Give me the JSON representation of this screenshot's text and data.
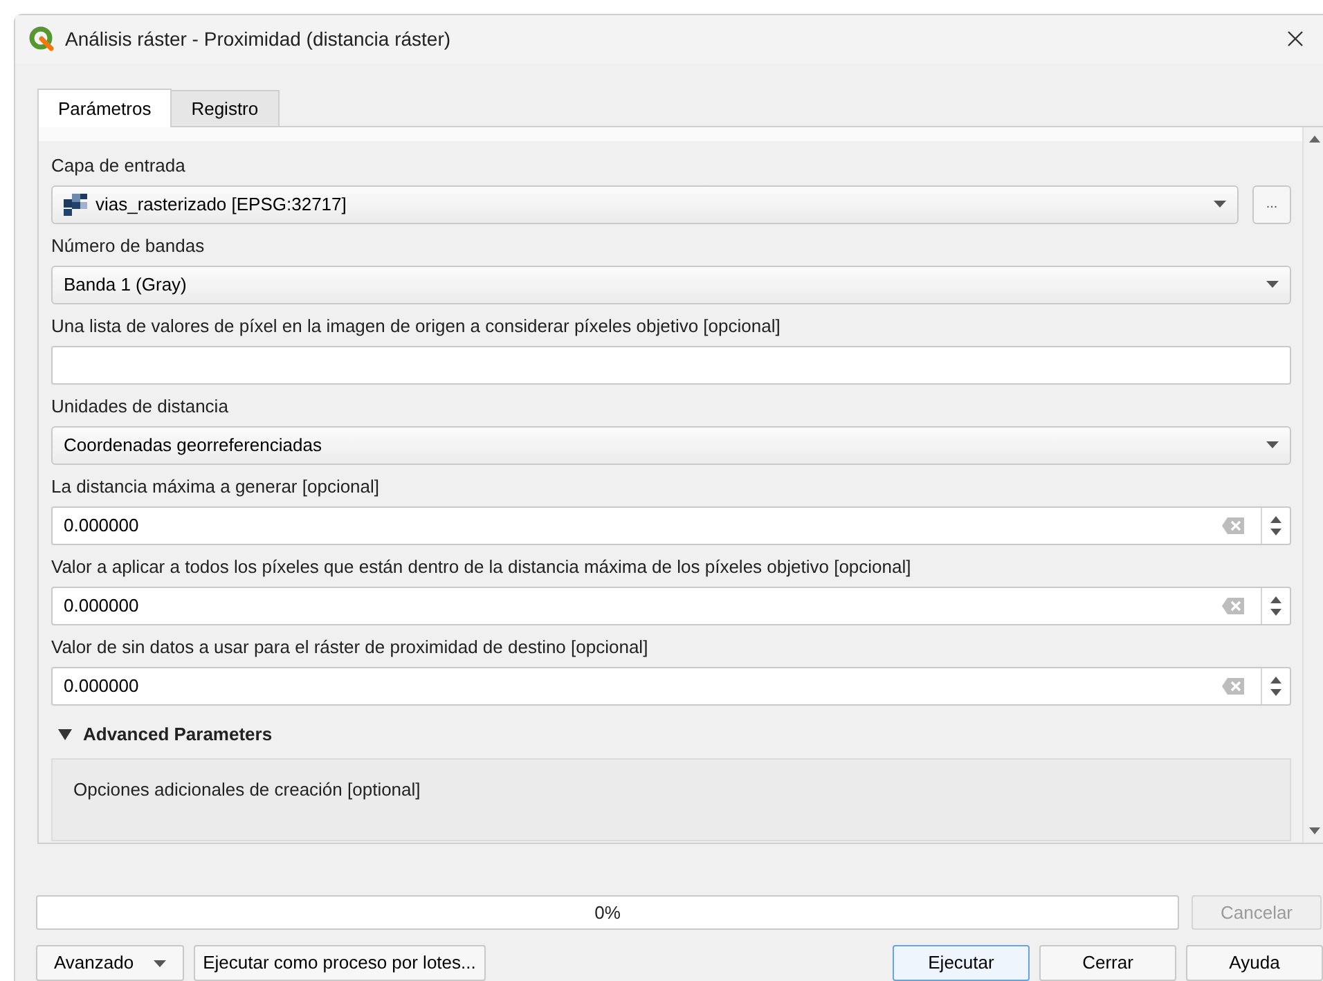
{
  "window": {
    "title": "Análisis ráster - Proximidad (distancia ráster)"
  },
  "tabs": [
    {
      "label": "Parámetros",
      "selected": true
    },
    {
      "label": "Registro",
      "selected": false
    }
  ],
  "parameters": [
    {
      "kind": "combo",
      "label": "Capa de entrada",
      "value": "vias_rasterizado [EPSG:32717]",
      "layer_icon": true,
      "browse_button": "..."
    },
    {
      "kind": "combo",
      "label": "Número de bandas",
      "value": "Banda 1 (Gray)"
    },
    {
      "kind": "text",
      "label": "Una lista de valores de píxel en la imagen de origen a considerar píxeles objetivo [opcional]"
    },
    {
      "kind": "combo",
      "label": "Unidades de distancia",
      "value": "Coordenadas georreferenciadas"
    },
    {
      "kind": "number",
      "label": "La distancia máxima a generar [opcional]",
      "value": "0.000000"
    },
    {
      "kind": "number",
      "label": "Valor a aplicar a todos los píxeles que están dentro de la distancia máxima de los píxeles objetivo [opcional]",
      "value": "0.000000"
    },
    {
      "kind": "number",
      "label": "Valor de sin datos a usar para el ráster de proximidad de destino [opcional]",
      "value": "0.000000"
    }
  ],
  "advanced": {
    "title": "Advanced Parameters",
    "expanded": true,
    "items": [
      "Opciones adicionales de creación [optional]"
    ]
  },
  "progress": {
    "label": "0%",
    "level": 0
  },
  "cancel_button": {
    "label": "Cancelar",
    "disabled": true
  },
  "buttons": [
    {
      "kind": "menu",
      "label": "Avanzado"
    },
    {
      "kind": "plain",
      "label": "Ejecutar como proceso por lotes..."
    },
    {
      "kind": "spacer"
    },
    {
      "kind": "default",
      "label": "Ejecutar"
    },
    {
      "kind": "plain",
      "label": "Cerrar"
    },
    {
      "kind": "plain",
      "label": "Ayuda"
    }
  ]
}
